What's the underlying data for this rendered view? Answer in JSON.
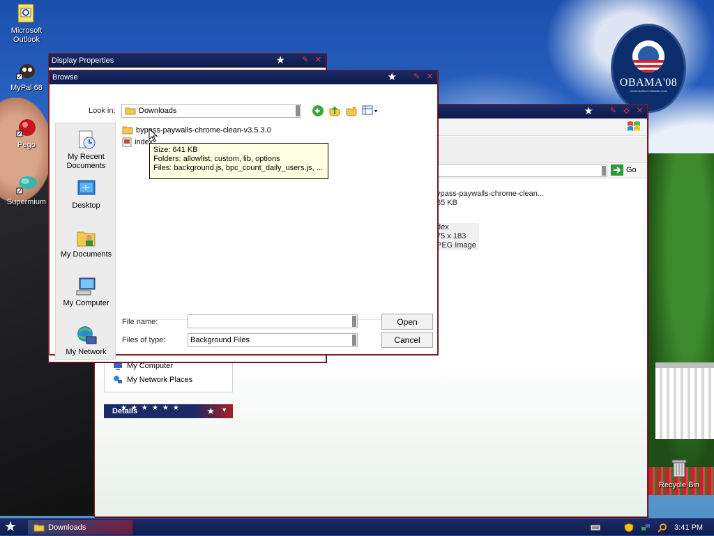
{
  "desktop": {
    "icons": [
      {
        "label": "Microsoft Outlook",
        "line1": "Microsoft",
        "line2": "Outlook"
      },
      {
        "label": "MyPal 68"
      },
      {
        "label": "Pego"
      },
      {
        "label": "Supermium"
      },
      {
        "label": "Recycle Bin"
      }
    ],
    "wallpaper_badge": {
      "text": "OBAMA'08",
      "url": "WWW.BARACKOBAMA.COM"
    }
  },
  "display_properties": {
    "title": "Display Properties"
  },
  "browse": {
    "title": "Browse",
    "look_in_label": "Look in:",
    "look_in_value": "Downloads",
    "places": [
      {
        "line1": "My Recent",
        "line2": "Documents"
      },
      {
        "line1": "Desktop"
      },
      {
        "line1": "My Documents"
      },
      {
        "line1": "My Computer"
      },
      {
        "line1": "My Network"
      }
    ],
    "files": [
      {
        "name": "bypass-paywalls-chrome-clean-v3.5.3.0",
        "type": "folder"
      },
      {
        "name": "index",
        "type": "image"
      }
    ],
    "tooltip": {
      "size": "Size: 641 KB",
      "folders": "Folders: allowlist, custom, lib, options",
      "files": "Files: background.js, bpc_count_daily_users.js, ..."
    },
    "file_name_label": "File name:",
    "file_name_value": "",
    "files_of_type_label": "Files of type:",
    "files_of_type_value": "Background Files",
    "open_label": "Open",
    "cancel_label": "Cancel"
  },
  "explorer": {
    "go_label": "Go",
    "item1_name": "ypass-paywalls-chrome-clean...",
    "item1_size": "65 KB",
    "item2_name": "dex",
    "item2_dims": "75 x 183",
    "item2_type": "PEG Image",
    "tasks": [
      "My Computer",
      "My Network Places"
    ],
    "details_label": "Details"
  },
  "taskbar": {
    "task_label": "Downloads",
    "clock": "3:41 PM"
  },
  "colors": {
    "title_navy": "#1b2a66",
    "accent_red": "#c0272d",
    "tooltip_bg": "#ffffe1"
  }
}
